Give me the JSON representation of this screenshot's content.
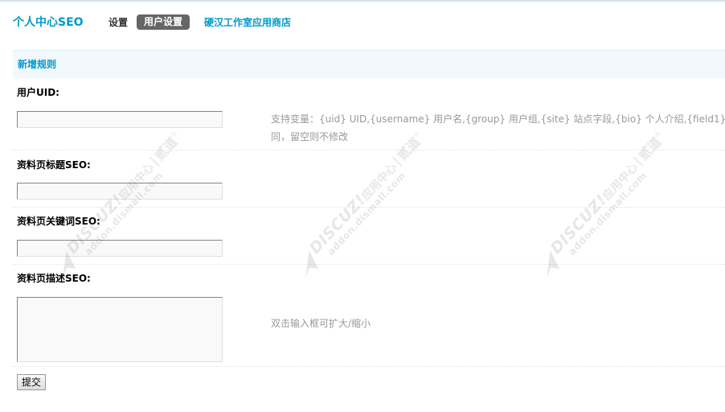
{
  "header": {
    "title": "个人中心SEO",
    "tabs": [
      {
        "label": "设置",
        "active": false
      },
      {
        "label": "用户设置",
        "active": true
      },
      {
        "label": "硬汉工作室应用商店",
        "active": false
      }
    ]
  },
  "section": {
    "title": "新增规则"
  },
  "form": {
    "fields": [
      {
        "label": "用户UID:",
        "value": "",
        "help": [
          "支持变量：{uid} UID,{username} 用户名,{group} 用户组,{site} 站点字段,{bio} 个人介绍,{field1}",
          "同，留空则不修改"
        ]
      },
      {
        "label": "资料页标题SEO:",
        "value": ""
      },
      {
        "label": "资料页关键词SEO:",
        "value": ""
      },
      {
        "label": "资料页描述SEO:",
        "value": "",
        "help": [
          "双击输入框可扩大/缩小"
        ]
      }
    ],
    "submit_label": "提交"
  },
  "watermark": {
    "brand": "DISCUZ!",
    "brand_cn": "应用中心",
    "mark": "贰道",
    "registered": "®",
    "url": "addon.dismall.com"
  },
  "colors": {
    "accent": "#0099cc",
    "active_tab_bg": "#666666",
    "section_bg": "#f2f9fd",
    "help_text": "#999999"
  }
}
